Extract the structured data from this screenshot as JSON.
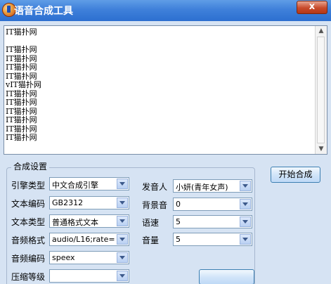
{
  "window": {
    "title": "语音合成工具",
    "close_label": "x"
  },
  "textarea": {
    "content": "IT猫扑网\n\nIT猫扑网\nIT猫扑网\nIT猫扑网\nIT猫扑网\nvIT猫扑网\nIT猫扑网\nIT猫扑网\nIT猫扑网\nIT猫扑网\nIT猫扑网\nIT猫扑网"
  },
  "settings": {
    "group_title": "合成设置",
    "engine": {
      "label": "引擎类型",
      "value": "中文合成引擎"
    },
    "encoding": {
      "label": "文本编码",
      "value": "GB2312"
    },
    "text_type": {
      "label": "文本类型",
      "value": "普通格式文本"
    },
    "audio_format": {
      "label": "音频格式",
      "value": "audio/L16;rate="
    },
    "audio_codec": {
      "label": "音频编码",
      "value": "speex"
    },
    "compress": {
      "label": "压缩等级",
      "value": ""
    },
    "speaker": {
      "label": "发音人",
      "value": "小妍(青年女声)"
    },
    "bg_sound": {
      "label": "背景音",
      "value": "0"
    },
    "speed": {
      "label": "语速",
      "value": "5"
    },
    "volume": {
      "label": "音量",
      "value": "5"
    }
  },
  "buttons": {
    "start": "开始合成"
  }
}
